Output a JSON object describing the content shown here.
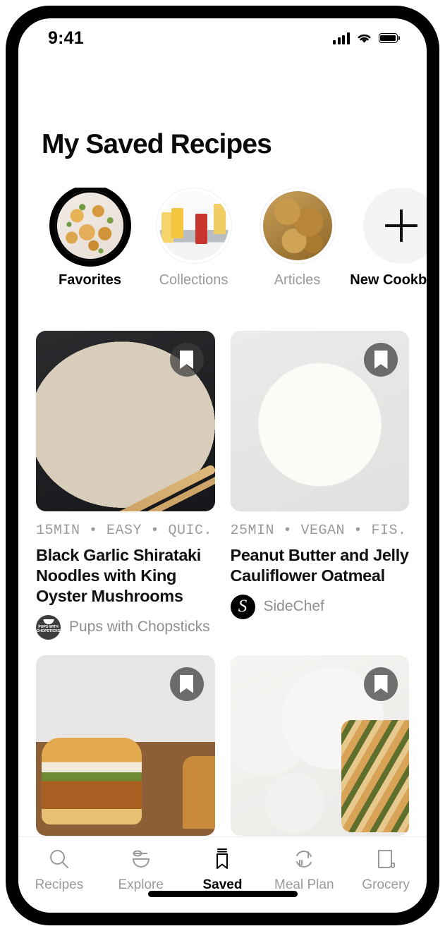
{
  "status_bar": {
    "time": "9:41",
    "signal_icon": "cellular-signal-icon",
    "wifi_icon": "wifi-icon",
    "battery_icon": "battery-full-icon"
  },
  "header": {
    "title": "My Saved Recipes"
  },
  "stories": [
    {
      "label": "Favorites",
      "active": true,
      "type": "image",
      "image_alt": "pasta-salad-bowl"
    },
    {
      "label": "Collections",
      "active": false,
      "type": "image",
      "image_alt": "cocktail-drinks-on-tray"
    },
    {
      "label": "Articles",
      "active": false,
      "type": "image",
      "image_alt": "baked-bread-casserole"
    },
    {
      "label": "New Cookbook",
      "active": true,
      "type": "add",
      "icon": "plus-icon"
    }
  ],
  "recipes": [
    {
      "meta": "15MIN • EASY • QUIC...",
      "title": "Black Garlic Shirataki Noodles with King Oyster Mushrooms",
      "author": "Pups with Chopsticks",
      "avatar_text": "PUPS WITH CHOPSTICKS",
      "bookmark_icon": "bookmark-icon",
      "saved": true,
      "image_alt": "mushrooms-in-beige-bowl-with-chopsticks"
    },
    {
      "meta": "25MIN • VEGAN • FIS...",
      "title": "Peanut Butter and Jelly Cauliflower Oatmeal",
      "author": "SideChef",
      "avatar_text": "S",
      "bookmark_icon": "bookmark-icon",
      "saved": true,
      "image_alt": "oatmeal-bowl-with-jam-and-apple-slices"
    },
    {
      "meta": "",
      "title": "",
      "author": "",
      "avatar_text": "",
      "bookmark_icon": "bookmark-icon",
      "saved": true,
      "image_alt": "fried-chicken-sliders"
    },
    {
      "meta": "",
      "title": "",
      "author": "",
      "avatar_text": "",
      "bookmark_icon": "bookmark-icon",
      "saved": true,
      "image_alt": "pistachio-swirl-bread-slices"
    }
  ],
  "tabbar": {
    "items": [
      {
        "label": "Recipes",
        "icon": "search-icon",
        "active": false
      },
      {
        "label": "Explore",
        "icon": "bowl-whisk-icon",
        "active": false
      },
      {
        "label": "Saved",
        "icon": "bookmark-icon",
        "active": true
      },
      {
        "label": "Meal Plan",
        "icon": "meal-plan-icon",
        "active": false
      },
      {
        "label": "Grocery",
        "icon": "receipt-icon",
        "active": false
      }
    ]
  },
  "colors": {
    "accent": "#000000",
    "muted_text": "#9a9a9a",
    "badge_bg": "#3c3c3c",
    "add_circle_bg": "#f4f4f4"
  }
}
